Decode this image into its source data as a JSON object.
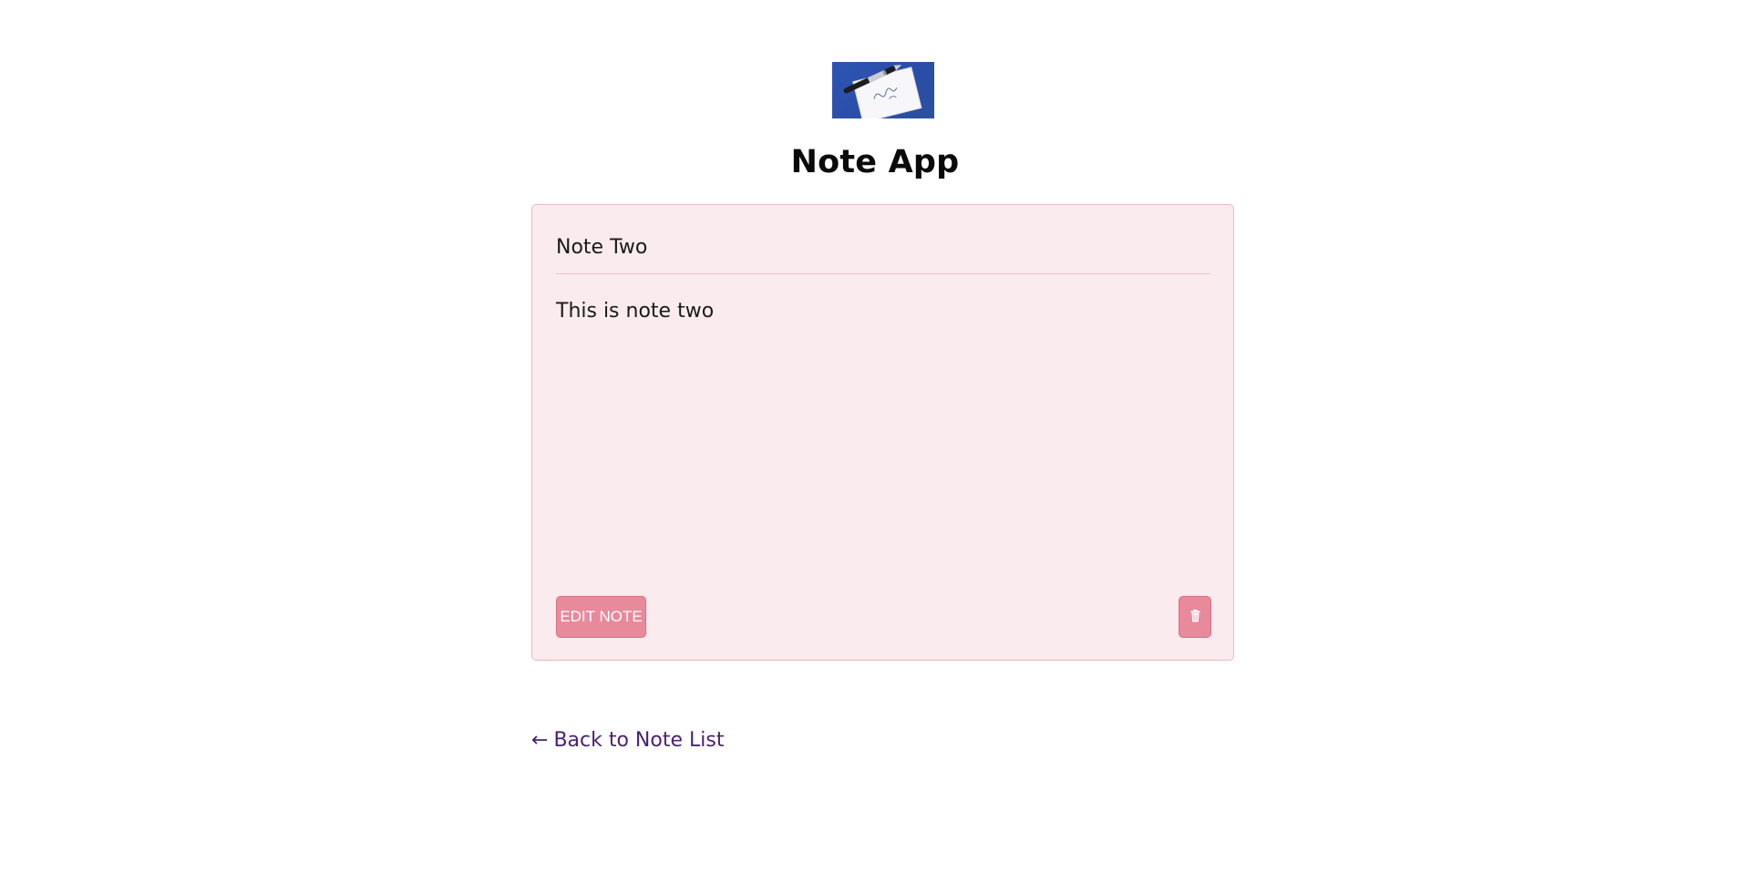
{
  "app": {
    "title": "Note App",
    "logo_icon": "note-card-pen-icon"
  },
  "note": {
    "title": "Note Two",
    "body": "This is note two",
    "edit_label": "EDIT NOTE",
    "delete_icon": "trash-icon"
  },
  "navigation": {
    "back_arrow": "←",
    "back_label": "Back to Note List"
  },
  "colors": {
    "card_background": "#f9ebee",
    "card_border": "#f0b6c2",
    "button_accent": "#e88a9c",
    "link": "#4b2175",
    "logo_blue": "#2e55b4"
  }
}
